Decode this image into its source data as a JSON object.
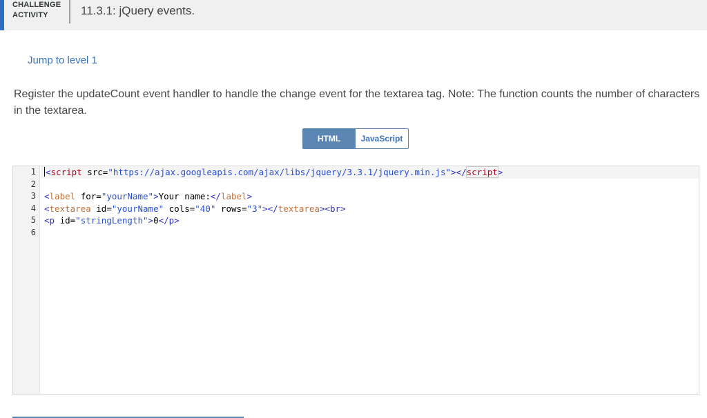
{
  "header": {
    "badge_line1": "CHALLENGE",
    "badge_line2": "ACTIVITY",
    "title": "11.3.1: jQuery events."
  },
  "jump_link": "Jump to level 1",
  "instructions": "Register the updateCount event handler to handle the change event for the textarea tag. Note: The function counts the number of characters in the textarea.",
  "tabs": [
    {
      "label": "HTML",
      "active": true
    },
    {
      "label": "JavaScript",
      "active": false
    }
  ],
  "editor": {
    "line_numbers": [
      "1",
      "2",
      "3",
      "4",
      "5",
      "6"
    ],
    "lines": [
      {
        "open": "<",
        "tag": "script",
        "attr": " src=",
        "val": "\"https://ajax.googleapis.com/ajax/libs/jquery/3.3.1/jquery.min.js\"",
        "close": ">",
        "end_open": "</",
        "end_tag": "script",
        "end_close": ">"
      },
      {},
      {
        "open": "<",
        "tag": "label",
        "attr": " for=",
        "val": "\"yourName\"",
        "close": ">",
        "text": "Your name:",
        "end_open": "</",
        "end_tag": "label",
        "end_close": ">"
      },
      {
        "open": "<",
        "tag": "textarea",
        "attr1": " id=",
        "val1": "\"yourName\"",
        "attr2": " cols=",
        "val2": "\"40\"",
        "attr3": " rows=",
        "val3": "\"3\"",
        "close": ">",
        "end_open": "</",
        "end_tag": "textarea",
        "end_close": ">",
        "br": "<br>"
      },
      {
        "open": "<p",
        "attr": " id=",
        "val": "\"stringLength\"",
        "close": ">",
        "text": "0",
        "end": "</p>"
      },
      {}
    ]
  },
  "colors": {
    "accent": "#2f6fbd",
    "tab_active": "#5b86b4",
    "link": "#3a72b8"
  }
}
